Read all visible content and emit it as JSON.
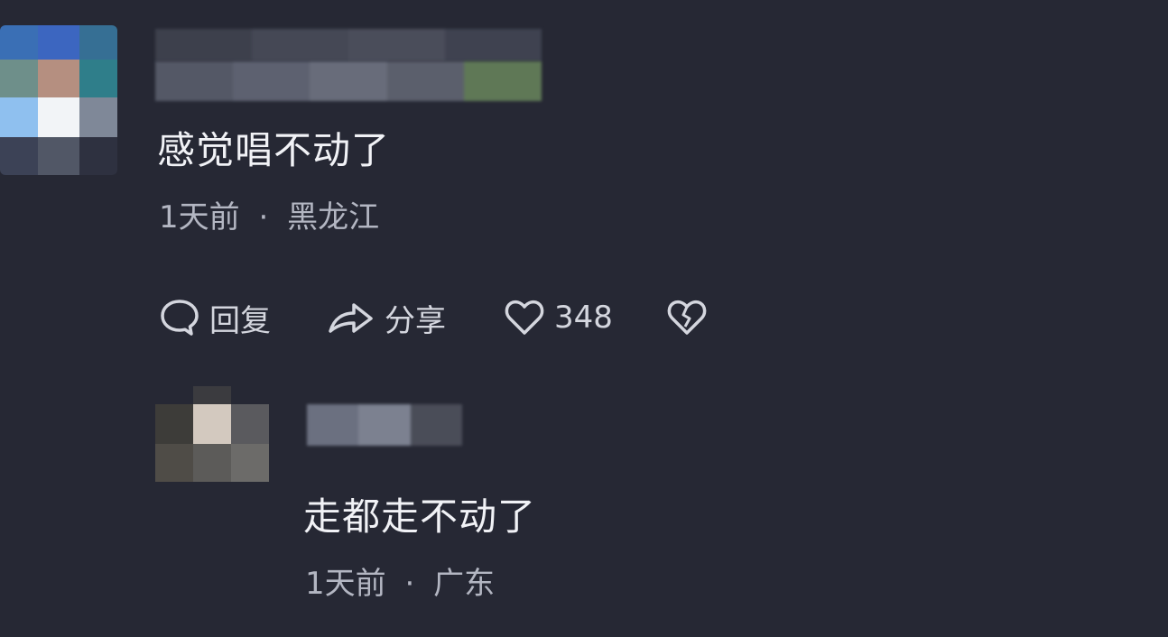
{
  "comments": [
    {
      "text": "感觉唱不动了",
      "time": "1天前",
      "separator": "·",
      "location": "黑龙江",
      "actions": {
        "reply_label": "回复",
        "share_label": "分享",
        "like_count": "348"
      },
      "avatar_colors": [
        "#3a6fb5",
        "#3c66c0",
        "#366f94",
        "#6e8f8a",
        "#b58f80",
        "#2f7e8a",
        "#8fc0ef",
        "#f2f4f7",
        "#7f8898",
        "#3c4256",
        "#515766",
        "#2e3140"
      ]
    },
    {
      "text": "走都走不动了",
      "time": "1天前",
      "separator": "·",
      "location": "广东",
      "avatar_colors": [
        "#262834",
        "#3b3b3f",
        "#262834",
        "#3d3c39",
        "#d3c9bf",
        "#5a5a5e",
        "#4f4c47",
        "#5c5b59",
        "#6c6b69"
      ]
    }
  ],
  "blurred_name_colors": {
    "row1a": [
      "#3d404c",
      "#454855",
      "#4a4d5a",
      "#3f4250"
    ],
    "row1b": [
      "#545866",
      "#5d6170",
      "#686c7a",
      "#5b5f6c",
      "#5f7856"
    ],
    "row2": [
      "#6b7080",
      "#7c8190",
      "#4a4d58"
    ]
  },
  "icons": {
    "reply": "speech-bubble-icon",
    "share": "share-arrow-icon",
    "like": "heart-icon",
    "dislike": "broken-heart-icon"
  },
  "colors": {
    "background": "#262834",
    "comment_text": "#f1f2f6",
    "meta_text": "#b3b6c2",
    "action_text": "#d4d6de"
  }
}
